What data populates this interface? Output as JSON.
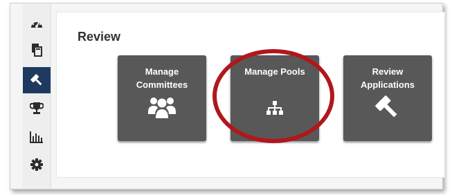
{
  "page": {
    "title": "Review"
  },
  "sidebar": {
    "items": [
      {
        "icon": "dashboard-icon",
        "active": false
      },
      {
        "icon": "documents-icon",
        "active": false
      },
      {
        "icon": "gavel-icon",
        "active": true
      },
      {
        "icon": "trophy-icon",
        "active": false
      },
      {
        "icon": "bar-chart-icon",
        "active": false
      },
      {
        "icon": "gear-icon",
        "active": false
      }
    ]
  },
  "tiles": [
    {
      "label": "Manage\nCommittees",
      "icon": "users-group-icon"
    },
    {
      "label": "Manage Pools",
      "icon": "sitemap-icon"
    },
    {
      "label": "Review\nApplications",
      "icon": "gavel-icon"
    }
  ],
  "colors": {
    "tile_bg": "#585858",
    "sidebar_active": "#1f3a5f",
    "highlight_ring": "#b0171c"
  }
}
